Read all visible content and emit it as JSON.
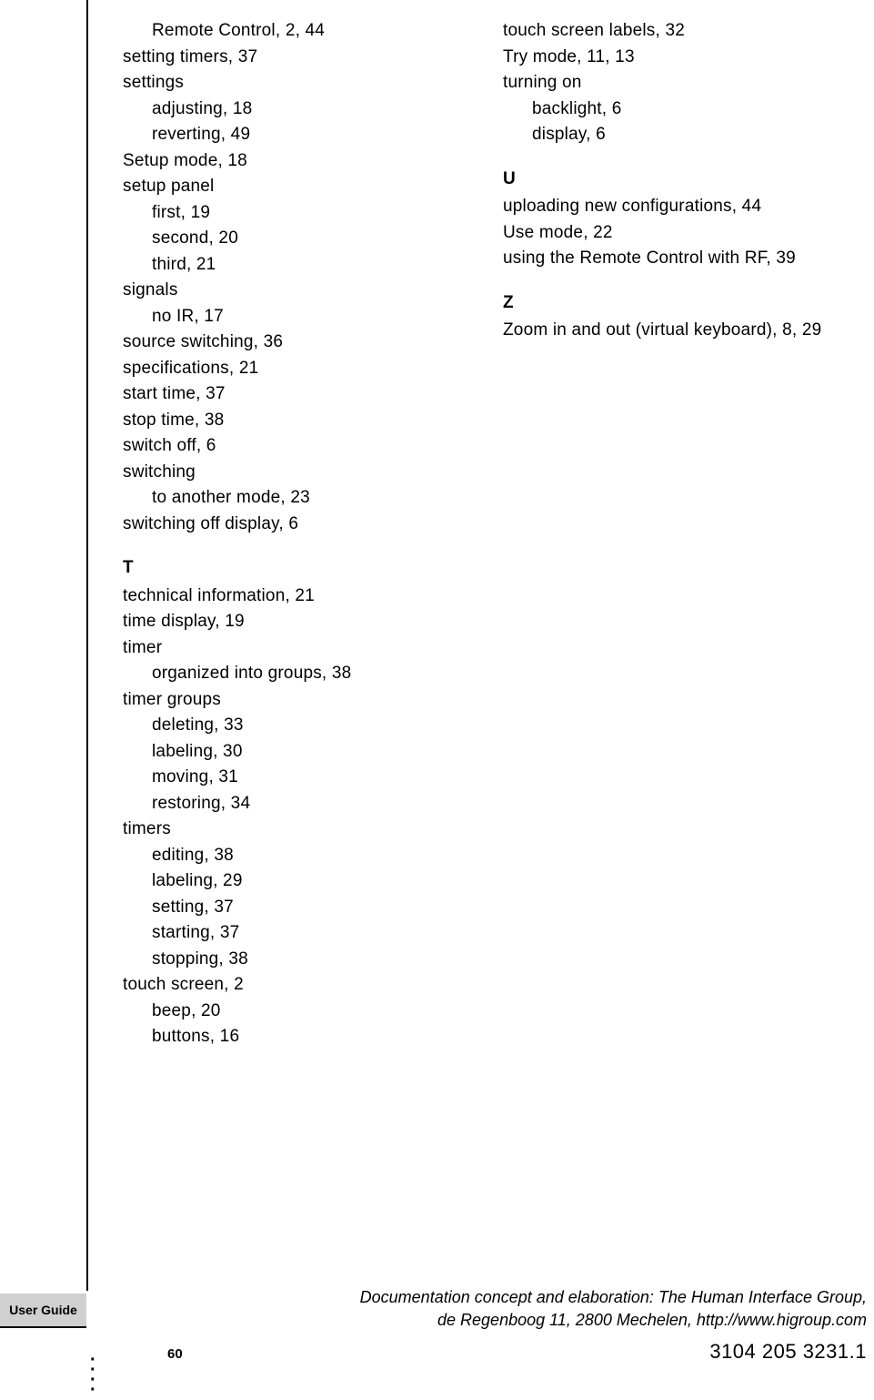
{
  "left_column": [
    {
      "text": "Remote Control, 2, 44",
      "sub": true
    },
    {
      "text": "setting timers, 37"
    },
    {
      "text": "settings"
    },
    {
      "text": "adjusting, 18",
      "sub": true
    },
    {
      "text": "reverting, 49",
      "sub": true
    },
    {
      "text": "Setup mode, 18"
    },
    {
      "text": "setup panel"
    },
    {
      "text": "first, 19",
      "sub": true
    },
    {
      "text": "second, 20",
      "sub": true
    },
    {
      "text": "third, 21",
      "sub": true
    },
    {
      "text": "signals"
    },
    {
      "text": "no IR, 17",
      "sub": true
    },
    {
      "text": "source switching, 36"
    },
    {
      "text": "specifications, 21"
    },
    {
      "text": "start time, 37"
    },
    {
      "text": "stop time, 38"
    },
    {
      "text": "switch off, 6"
    },
    {
      "text": "switching"
    },
    {
      "text": "to another mode, 23",
      "sub": true
    },
    {
      "text": "switching off display, 6"
    },
    {
      "text": "T",
      "heading": true
    },
    {
      "text": "technical information, 21"
    },
    {
      "text": "time display, 19"
    },
    {
      "text": "timer"
    },
    {
      "text": "organized into groups, 38",
      "sub": true
    },
    {
      "text": "timer groups"
    },
    {
      "text": "deleting, 33",
      "sub": true
    },
    {
      "text": "labeling, 30",
      "sub": true
    },
    {
      "text": "moving, 31",
      "sub": true
    },
    {
      "text": "restoring, 34",
      "sub": true
    },
    {
      "text": "timers"
    },
    {
      "text": "editing, 38",
      "sub": true
    },
    {
      "text": "labeling, 29",
      "sub": true
    },
    {
      "text": "setting, 37",
      "sub": true
    },
    {
      "text": "starting, 37",
      "sub": true
    },
    {
      "text": "stopping, 38",
      "sub": true
    },
    {
      "text": "touch screen, 2"
    },
    {
      "text": "beep, 20",
      "sub": true
    },
    {
      "text": "buttons, 16",
      "sub": true
    }
  ],
  "right_column": [
    {
      "text": "touch screen labels, 32"
    },
    {
      "text": "Try mode, 11, 13"
    },
    {
      "text": "turning on"
    },
    {
      "text": "backlight, 6",
      "sub": true
    },
    {
      "text": "display, 6",
      "sub": true
    },
    {
      "text": "U",
      "heading": true
    },
    {
      "text": "uploading new configurations, 44"
    },
    {
      "text": "Use mode, 22"
    },
    {
      "text": "using the Remote Control with RF, 39"
    },
    {
      "text": "Z",
      "heading": true
    },
    {
      "text": "Zoom in and out (virtual keyboard), 8, 29"
    }
  ],
  "footer": {
    "sidebar_label": "User Guide",
    "page_number": "60",
    "credit_line1": "Documentation concept and elaboration: The Human Interface Group,",
    "credit_line2": "de Regenboog 11, 2800 Mechelen, http://www.higroup.com",
    "doc_number": "3104 205 3231.1"
  }
}
